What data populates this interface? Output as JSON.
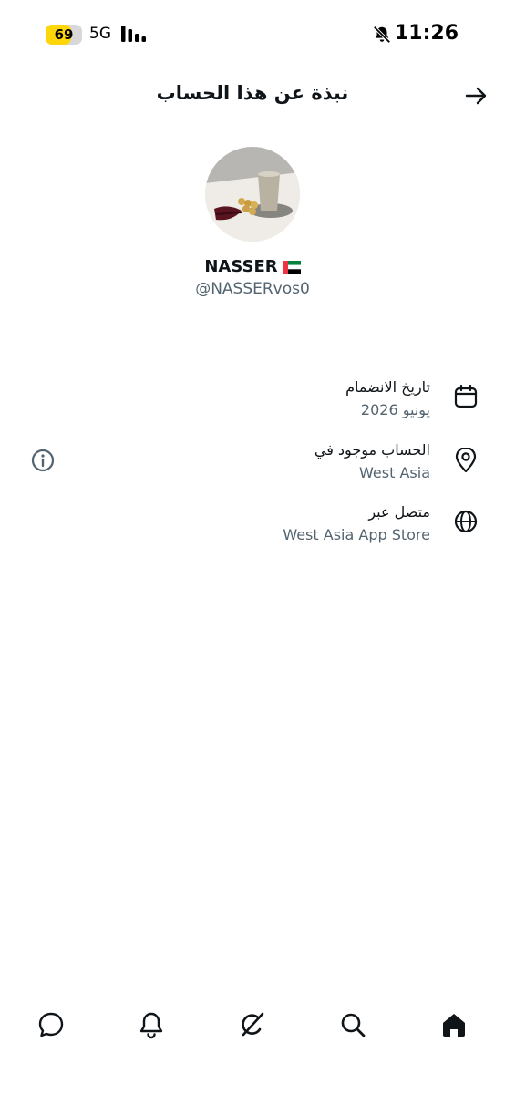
{
  "status_bar": {
    "battery_level": "69",
    "battery_fraction": 0.69,
    "network": "5G",
    "time": "11:26",
    "icons": [
      "signal-bars-icon",
      "bell-slash-icon"
    ]
  },
  "header": {
    "title": "نبذة عن هذا الحساب",
    "back_icon": "arrow-right-icon"
  },
  "profile": {
    "display_name": "NASSER",
    "flag": "uae-flag",
    "handle": "@NASSERvos0"
  },
  "info": {
    "joined": {
      "title": "تاريخ الانضمام",
      "value": "يونيو 2026",
      "icon": "calendar-icon"
    },
    "location": {
      "title": "الحساب موجود في",
      "value": "West Asia",
      "icon": "location-pin-icon"
    },
    "connected_via": {
      "title": "متصل عبر",
      "value": "West Asia App Store",
      "icon": "globe-icon"
    }
  },
  "bottom_nav": {
    "items": [
      "chat-icon",
      "bell-icon",
      "grok-icon",
      "search-icon",
      "home-icon"
    ],
    "active": "home-icon"
  },
  "colors": {
    "primary_text": "#0f1419",
    "secondary_text": "#536471",
    "battery": "#ffd60a"
  }
}
